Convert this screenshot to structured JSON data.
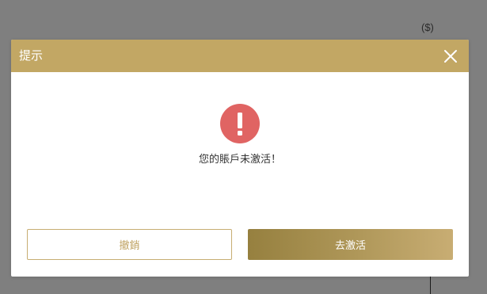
{
  "background": {
    "currency_label": "($)"
  },
  "modal": {
    "title": "提示",
    "close_icon": "close-icon",
    "alert_icon": "exclamation-icon",
    "message": "您的賬戶未激活！",
    "cancel_label": "撤銷",
    "activate_label": "去激活"
  },
  "colors": {
    "header_bg": "#c2a764",
    "alert_red": "#e06463",
    "cancel_border": "#c7ad72",
    "cancel_text": "#bfa262",
    "activate_gradient_start": "#96803f",
    "activate_gradient_end": "#c8ad73",
    "overlay": "#7f7f7f"
  }
}
